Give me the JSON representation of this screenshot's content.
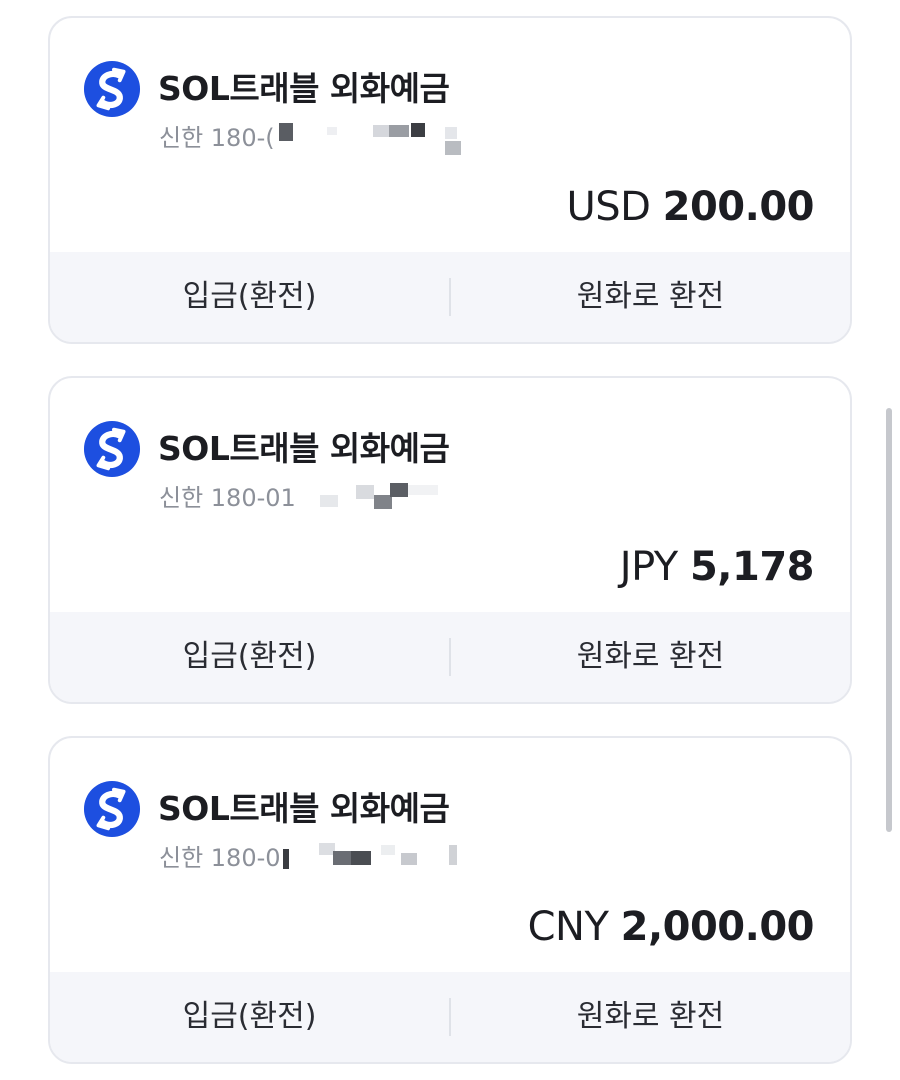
{
  "accounts": [
    {
      "title": "SOL트래블 외화예금",
      "number_visible": "신한 180-(",
      "currency": "USD",
      "amount": "200.00",
      "actions": {
        "deposit": "입금(환전)",
        "convert": "원화로 환전"
      }
    },
    {
      "title": "SOL트래블 외화예금",
      "number_visible": "신한 180-01",
      "currency": "JPY",
      "amount": "5,178",
      "actions": {
        "deposit": "입금(환전)",
        "convert": "원화로 환전"
      }
    },
    {
      "title": "SOL트래블 외화예금",
      "number_visible": "신한 180-0",
      "currency": "CNY",
      "amount": "2,000.00",
      "actions": {
        "deposit": "입금(환전)",
        "convert": "원화로 환전"
      }
    }
  ],
  "icons": {
    "bank_logo": "shinhan-bank-logo-icon"
  },
  "colors": {
    "brand": "#1d4fe0",
    "text": "#1c1d22",
    "subtext": "#8c9099",
    "action_bg": "#f5f6fa"
  }
}
